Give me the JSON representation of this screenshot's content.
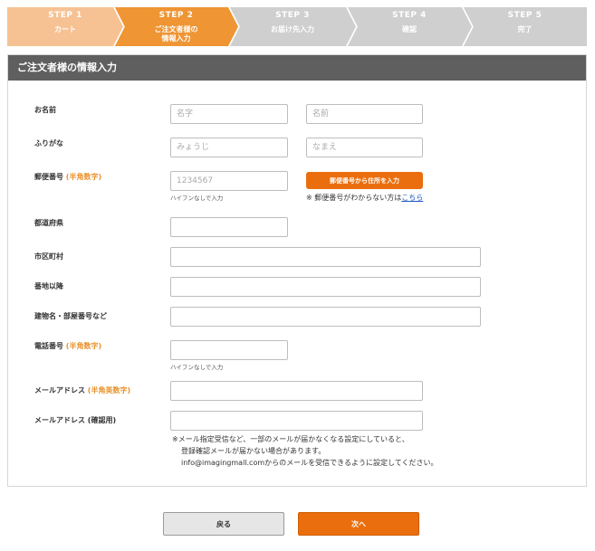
{
  "steps": [
    {
      "num": "STEP 1",
      "label": "カート",
      "label2": "",
      "color": "#f6c293"
    },
    {
      "num": "STEP 2",
      "label": "ご注文者様の",
      "label2": "情報入力",
      "color": "#ef9533"
    },
    {
      "num": "STEP 3",
      "label": "お届け先入力",
      "label2": "",
      "color": "#cfcfcf"
    },
    {
      "num": "STEP 4",
      "label": "確認",
      "label2": "",
      "color": "#cfcfcf"
    },
    {
      "num": "STEP 5",
      "label": "完了",
      "label2": "",
      "color": "#cfcfcf"
    }
  ],
  "panel": {
    "title": "ご注文者様の情報入力"
  },
  "form": {
    "name": {
      "label": "お名前",
      "sei_placeholder": "名字",
      "mei_placeholder": "名前"
    },
    "kana": {
      "label": "ふりがな",
      "sei_placeholder": "みょうじ",
      "mei_placeholder": "なまえ"
    },
    "zip": {
      "label": "郵便番号",
      "note": "(半角数字)",
      "placeholder": "1234567",
      "hint": "ハイフンなしで入力",
      "button": "郵便番号から住所を入力",
      "help_prefix": "※ 郵便番号がわからない方は",
      "help_link": "こちら"
    },
    "pref": {
      "label": "都道府県"
    },
    "city": {
      "label": "市区町村"
    },
    "street": {
      "label": "番地以降"
    },
    "building": {
      "label": "建物名・部屋番号など"
    },
    "tel": {
      "label": "電話番号",
      "note": "(半角数字)",
      "hint": "ハイフンなしで入力"
    },
    "email": {
      "label": "メールアドレス",
      "note": "(半角英数字)"
    },
    "email_confirm": {
      "label": "メールアドレス (確認用)"
    },
    "mail_note": {
      "line1": "※メール指定受信など、一部のメールが届かなくなる設定にしていると、",
      "line2": "登録確認メールが届かない場合があります。",
      "line3": "info@imagingmall.comからのメールを受信できるように設定してください。"
    }
  },
  "buttons": {
    "back": "戻る",
    "next": "次へ"
  }
}
